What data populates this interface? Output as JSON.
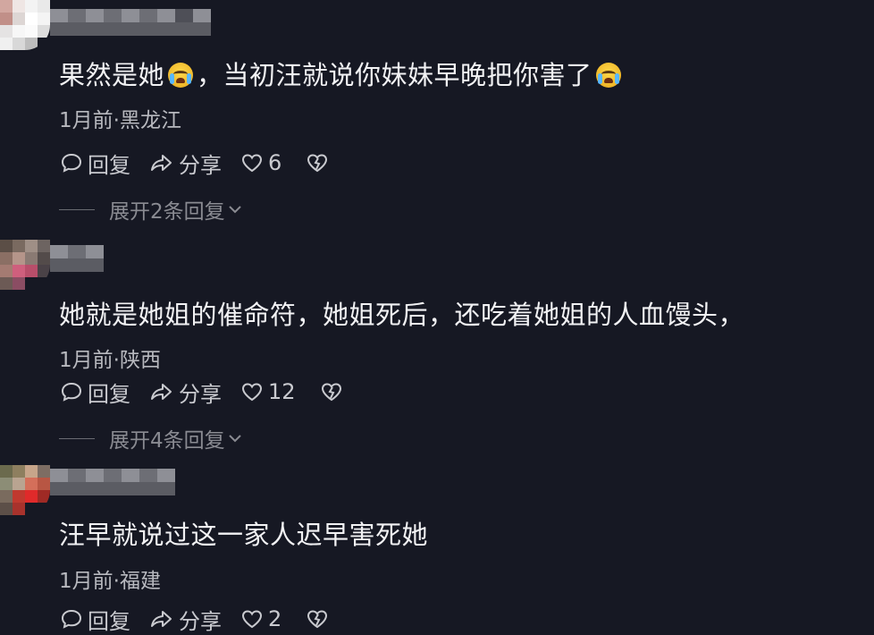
{
  "comments": [
    {
      "text_before_emoji": "果然是她",
      "text_middle": "，当初汪就说你妹妹早晚把你害了",
      "meta": "1月前·黑龙江",
      "reply_label": "回复",
      "share_label": "分享",
      "like_count": "6",
      "expand_label": "展开2条回复"
    },
    {
      "text": "她就是她姐的催命符，她姐死后，还吃着她姐的人血馒头，",
      "meta": "1月前·陕西",
      "reply_label": "回复",
      "share_label": "分享",
      "like_count": "12",
      "expand_label": "展开4条回复"
    },
    {
      "text": "汪早就说过这一家人迟早害死她",
      "meta": "1月前·福建",
      "reply_label": "回复",
      "share_label": "分享",
      "like_count": "2"
    }
  ],
  "colors": {
    "background": "#161823",
    "text": "#f2f2f4",
    "secondary": "#b8b9bf",
    "muted": "#8a8b92"
  },
  "icons": [
    "reply-bubble-icon",
    "share-arrow-icon",
    "heart-icon",
    "dislike-heart-icon",
    "chevron-down-icon",
    "crying-emoji-icon"
  ]
}
